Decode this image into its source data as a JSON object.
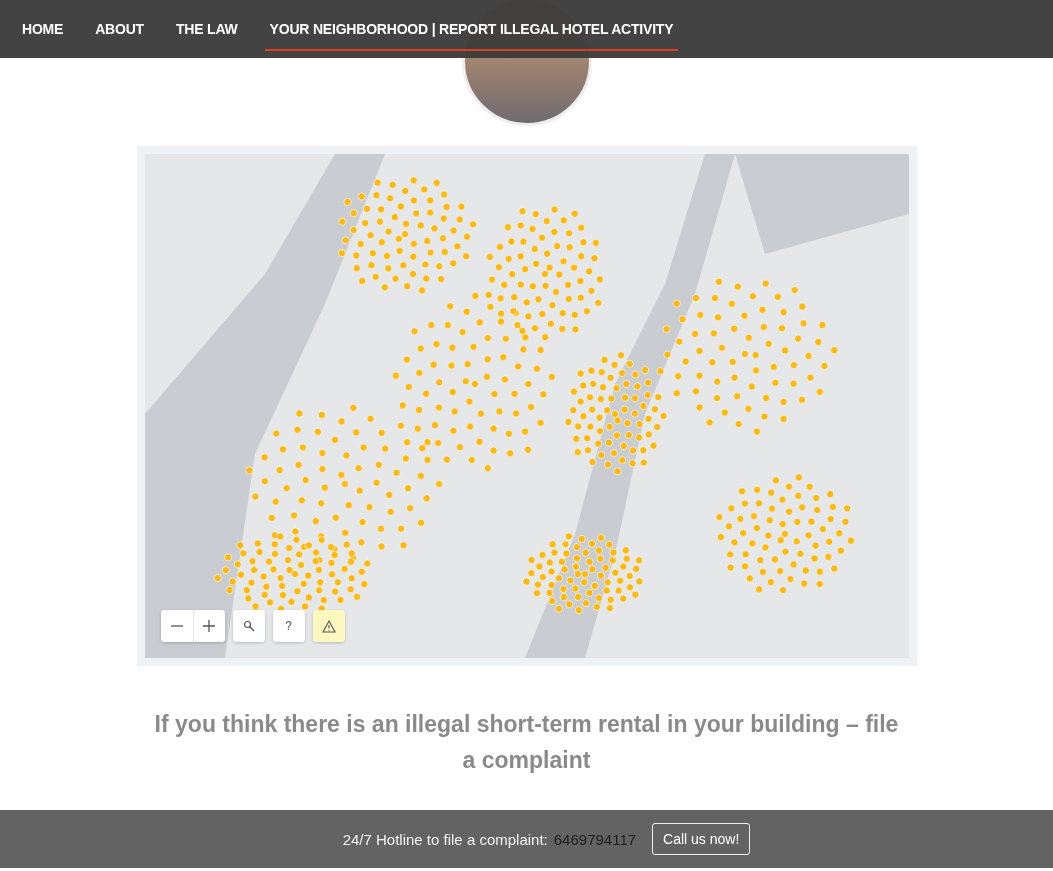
{
  "nav": {
    "items": [
      {
        "label": "HOME",
        "selected": false
      },
      {
        "label": "ABOUT",
        "selected": false
      },
      {
        "label": "THE LAW",
        "selected": false
      },
      {
        "label": "YOUR NEIGHBORHOOD | REPORT ILLEGAL HOTEL ACTIVITY",
        "selected": true
      }
    ]
  },
  "map": {
    "controls": [
      {
        "kind": "zoom_out",
        "selected": false
      },
      {
        "kind": "zoom_in",
        "selected": false
      },
      {
        "kind": "search",
        "selected": false
      },
      {
        "kind": "help",
        "label": "?",
        "selected": false
      },
      {
        "kind": "report",
        "selected": true
      }
    ]
  },
  "heading": "If you think there is an illegal short-term rental in your building –  file a complaint",
  "footer": {
    "text": "24/7 Hotline to file a complaint:",
    "phone": "6469794117",
    "button": "Call us now!"
  }
}
